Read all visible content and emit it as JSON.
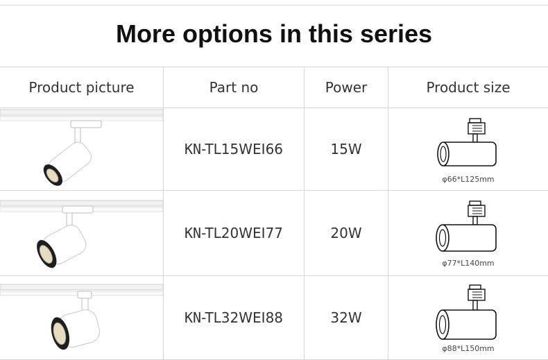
{
  "title": "More options in this series",
  "table": {
    "headers": [
      "Product picture",
      "Part no",
      "Power",
      "Product size"
    ],
    "rows": [
      {
        "part_prefix": "KN",
        "part_suffix": "-TL15WEI66",
        "power": "15W",
        "size": "φ66*L125mm",
        "image": "track-spotlight-icon"
      },
      {
        "part_prefix": "KN",
        "part_suffix": "-TL20WEI77",
        "power": "20W",
        "size": "φ77*L140mm",
        "image": "track-spotlight-icon"
      },
      {
        "part_prefix": "KN",
        "part_suffix": "-TL32WEI88",
        "power": "32W",
        "size": "φ88*L150mm",
        "image": "track-spotlight-icon"
      }
    ]
  },
  "colors": {
    "text": "#333333",
    "title": "#111111",
    "rule": "#d6d6d6",
    "lamp_body": "#ffffff",
    "lamp_face": "#222222",
    "lens": "#e8dcc0"
  }
}
